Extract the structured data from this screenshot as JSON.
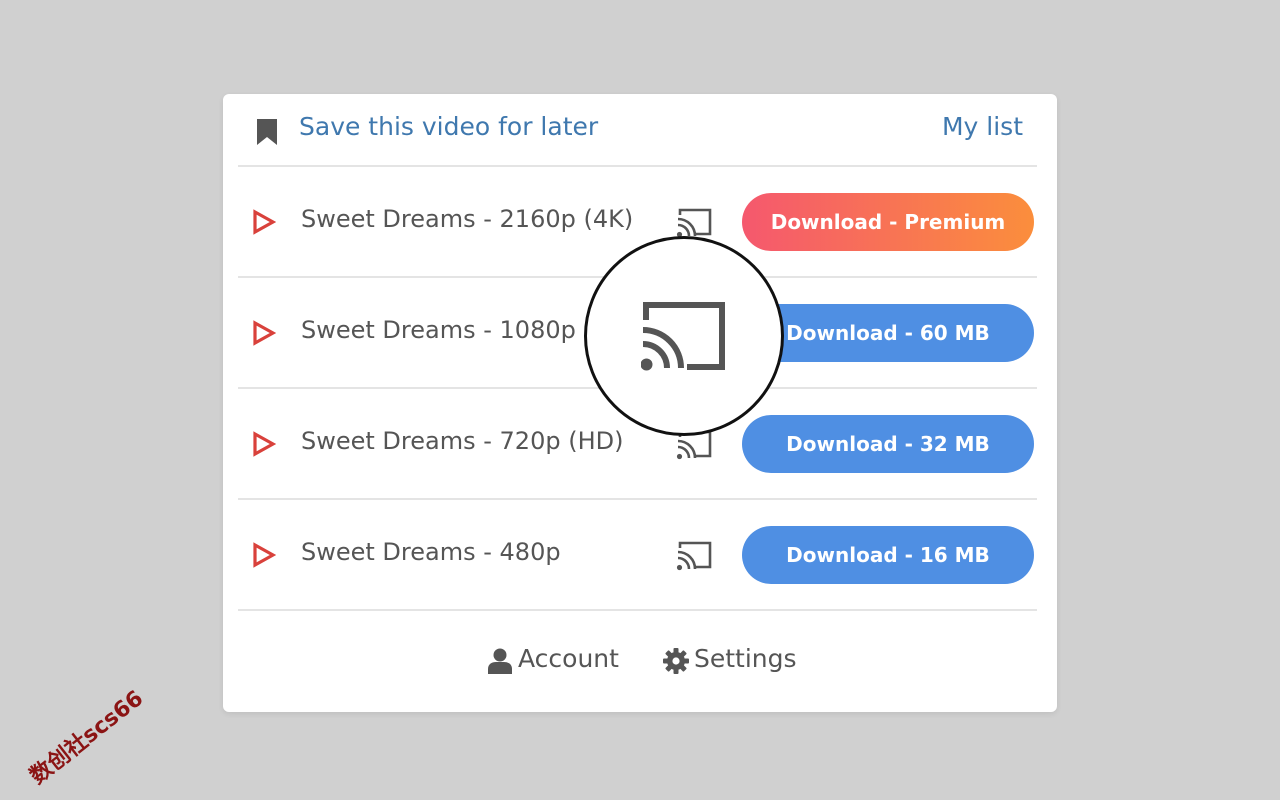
{
  "header": {
    "save_label": "Save this video for later",
    "mylist_label": "My list",
    "bookmark_icon": "bookmark-icon"
  },
  "rows": [
    {
      "title": "Sweet Dreams - 2160p (4K)",
      "button_label": "Download - Premium",
      "premium": true
    },
    {
      "title": "Sweet Dreams - 1080p",
      "button_label": "Download - 60 MB",
      "premium": false
    },
    {
      "title": "Sweet Dreams - 720p (HD)",
      "button_label": "Download - 32 MB",
      "premium": false
    },
    {
      "title": "Sweet Dreams - 480p",
      "button_label": "Download - 16 MB",
      "premium": false
    }
  ],
  "footer": {
    "account_label": "Account",
    "settings_label": "Settings"
  },
  "colors": {
    "link": "#3f78ae",
    "play": "#d9413b",
    "button": "#4f8fe3",
    "premium_start": "#f5586e",
    "premium_end": "#fb8e3c",
    "icon_gray": "#555555"
  },
  "watermark": "数创社scs66"
}
